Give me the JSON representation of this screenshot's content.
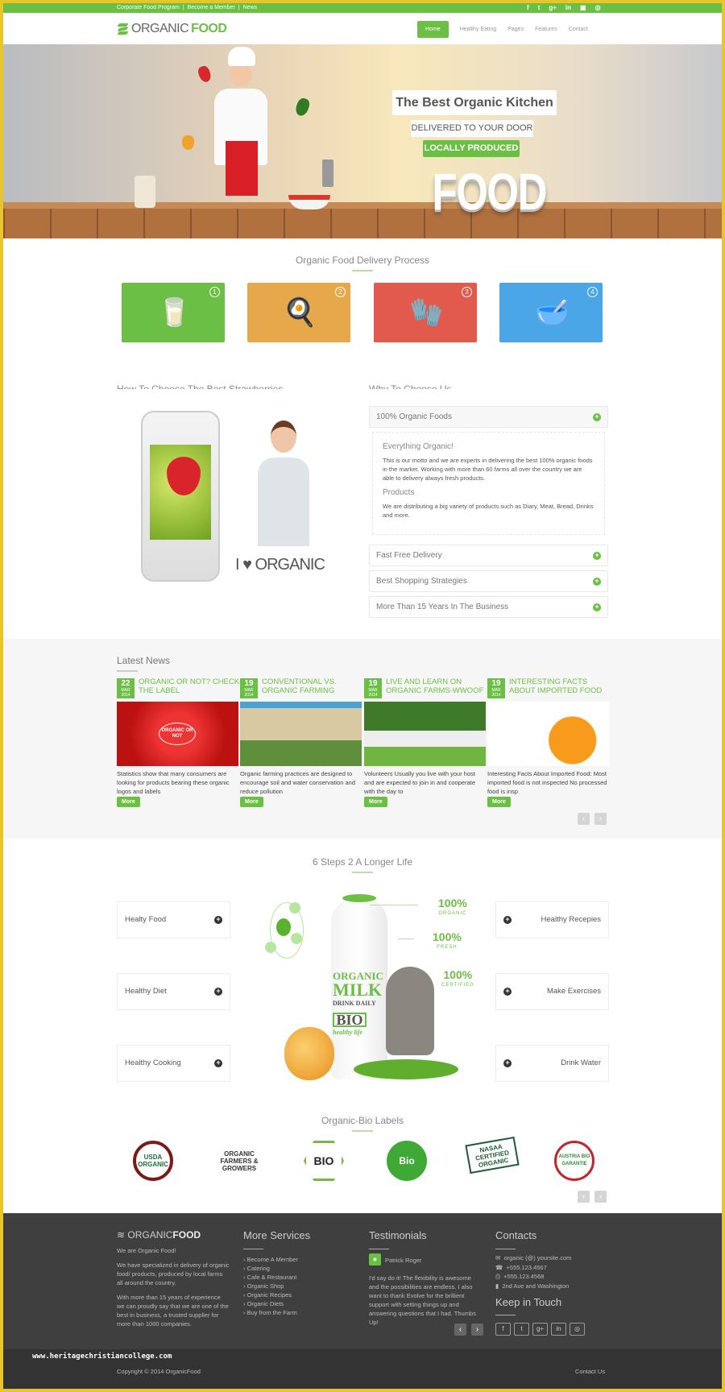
{
  "colors": {
    "brand": "#6cbf45",
    "frame": "#e8c52a",
    "step1": "#6cbf45",
    "step2": "#e6a84b",
    "step3": "#e25a4d",
    "step4": "#4aa6e6",
    "footer": "#3f3f3f"
  },
  "topbar": {
    "links": [
      "Corporate Food Program",
      "|",
      "Become a Member",
      "|",
      "News"
    ],
    "social": [
      "facebook-icon",
      "twitter-icon",
      "google-plus-icon",
      "linkedin-icon",
      "youtube-icon",
      "dribbble-icon"
    ],
    "social_glyphs": [
      "f",
      "t",
      "g+",
      "in",
      "▣",
      "◎"
    ]
  },
  "nav": {
    "logo_light": "ORGANIC",
    "logo_bold": "FOOD",
    "menu": [
      "Home",
      "Healthy Eating",
      "Pages",
      "Features",
      "Contact"
    ]
  },
  "hero": {
    "line1": "The Best Organic Kitchen",
    "line2": "DELIVERED TO YOUR DOOR",
    "line3": "LOCALLY PRODUCED",
    "line4": "FOOD"
  },
  "process": {
    "title": "Organic Food Delivery Process",
    "steps": [
      {
        "num": "1",
        "icon": "milk-bottle-icon",
        "glyph": "🥛"
      },
      {
        "num": "2",
        "icon": "chef-hat-utensils-icon",
        "glyph": "🍳"
      },
      {
        "num": "3",
        "icon": "oven-mitt-icon",
        "glyph": "🧤"
      },
      {
        "num": "4",
        "icon": "food-bowl-icon",
        "glyph": "🥣"
      }
    ]
  },
  "about": {
    "left_heading": "How To Choose The Best Strawberries",
    "right_heading": "Why To Choose Us",
    "promo": "I ♥ ORGANIC",
    "accordion": [
      "100% Organic Foods",
      "Fast Free Delivery",
      "Best Shopping Strategies",
      "More Than 15 Years In The Business"
    ],
    "panel": {
      "h1": "Everything Organic!",
      "p1": "This is our motto and we are experts in delivering the best 100% organic foods in the market. Working with more than 60 farms all over the country we are able to delivery always fresh products.",
      "h2": "Products",
      "p2": "We are distributing a big variety of products such as Diary, Meat, Bread, Drinks and more."
    }
  },
  "news": {
    "title": "Latest News",
    "more": "More",
    "prev": "‹",
    "next": "›",
    "items": [
      {
        "day": "22",
        "month": "MAR",
        "year": "2014",
        "title": "ORGANIC OR NOT? CHECK THE LABEL",
        "text": "Statistics show that many consumers are looking for products bearing these organic logos and labels",
        "image_text": "ORGANIC OR NOT"
      },
      {
        "day": "19",
        "month": "MAR",
        "year": "2014",
        "title": "CONVENTIONAL VS. ORGANIC FARMING",
        "text": "Organic farming practices are designed to encourage soil and water conservation and reduce pollution"
      },
      {
        "day": "19",
        "month": "MAR",
        "year": "2014",
        "title": "LIVE AND LEARN ON ORGANIC FARMS-WWOOF",
        "text": "Volunteers Usually you live with your host and are expected to join in and cooperate with the day to"
      },
      {
        "day": "19",
        "month": "MAR",
        "year": "2014",
        "title": "INTERESTING FACTS ABOUT IMPORTED FOOD",
        "text": "Interesting Facts About Imported Food: Most imported food is not inspected No processed food is insp"
      }
    ]
  },
  "steps": {
    "title": "6 Steps 2 A Longer Life",
    "left": [
      "Healty Food",
      "Healthy Diet",
      "Healthy Cooking"
    ],
    "right": [
      "Healthy Recepies",
      "Make Exercises",
      "Drink Water"
    ],
    "badges": [
      {
        "pct": "100%",
        "label": "ORGANIC"
      },
      {
        "pct": "100%",
        "label": "FRESH"
      },
      {
        "pct": "100%",
        "label": "CERTIFIED"
      }
    ],
    "bottle": {
      "l1": "ORGANIC",
      "l2": "MILK",
      "l3": "DRINK DAILY",
      "l4": "BIO",
      "l5": "healthy life"
    }
  },
  "labels": {
    "title": "Organic-Bio Labels",
    "logos": [
      "USDA ORGANIC",
      "ORGANIC FARMERS & GROWERS",
      "BIO",
      "Bio",
      "NASAA CERTIFIED ORGANIC",
      "AUSTRIA BIO GARANTIE"
    ]
  },
  "footer": {
    "about": {
      "logo_light": "ORGANIC",
      "logo_bold": "FOOD",
      "p1": "We are Organic Food!",
      "p2": "We have specialized in delivery of organic food/ products, produced by local farms all around the country.",
      "p3": "With more than 15 years of experience we can proudly say that we are one of the best in business, a trusted supplier for more than 1000 companies."
    },
    "services": {
      "title": "More Services",
      "items": [
        "Become A Member",
        "Catering",
        "Cafe & Restaurant",
        "Organic Shop",
        "Organic Recipes",
        "Organic Diets",
        "Buy from the Farm"
      ]
    },
    "testimonials": {
      "title": "Testimonials",
      "name": "Patrick Roger",
      "quote": "I'd say do it! The flexibility is awesome and the possibilities are endless. I also want to thank Evolve for the brillient support with setting things up and answering questions that I had. Thumbs Up!"
    },
    "contacts": {
      "title": "Contacts",
      "email": "organic (@) yoursite.com",
      "phone": "+555.123.4567",
      "fax": "+555.123.4568",
      "address": "2nd Ave and Washington",
      "keep_title": "Keep in Touch",
      "social": [
        "f",
        "t",
        "g+",
        "in",
        "◎"
      ]
    },
    "copyright": "Copyright © 2014 OrganicFood",
    "contact_link": "Contact Us",
    "watermark": "www.heritagechristiancollege.com"
  }
}
